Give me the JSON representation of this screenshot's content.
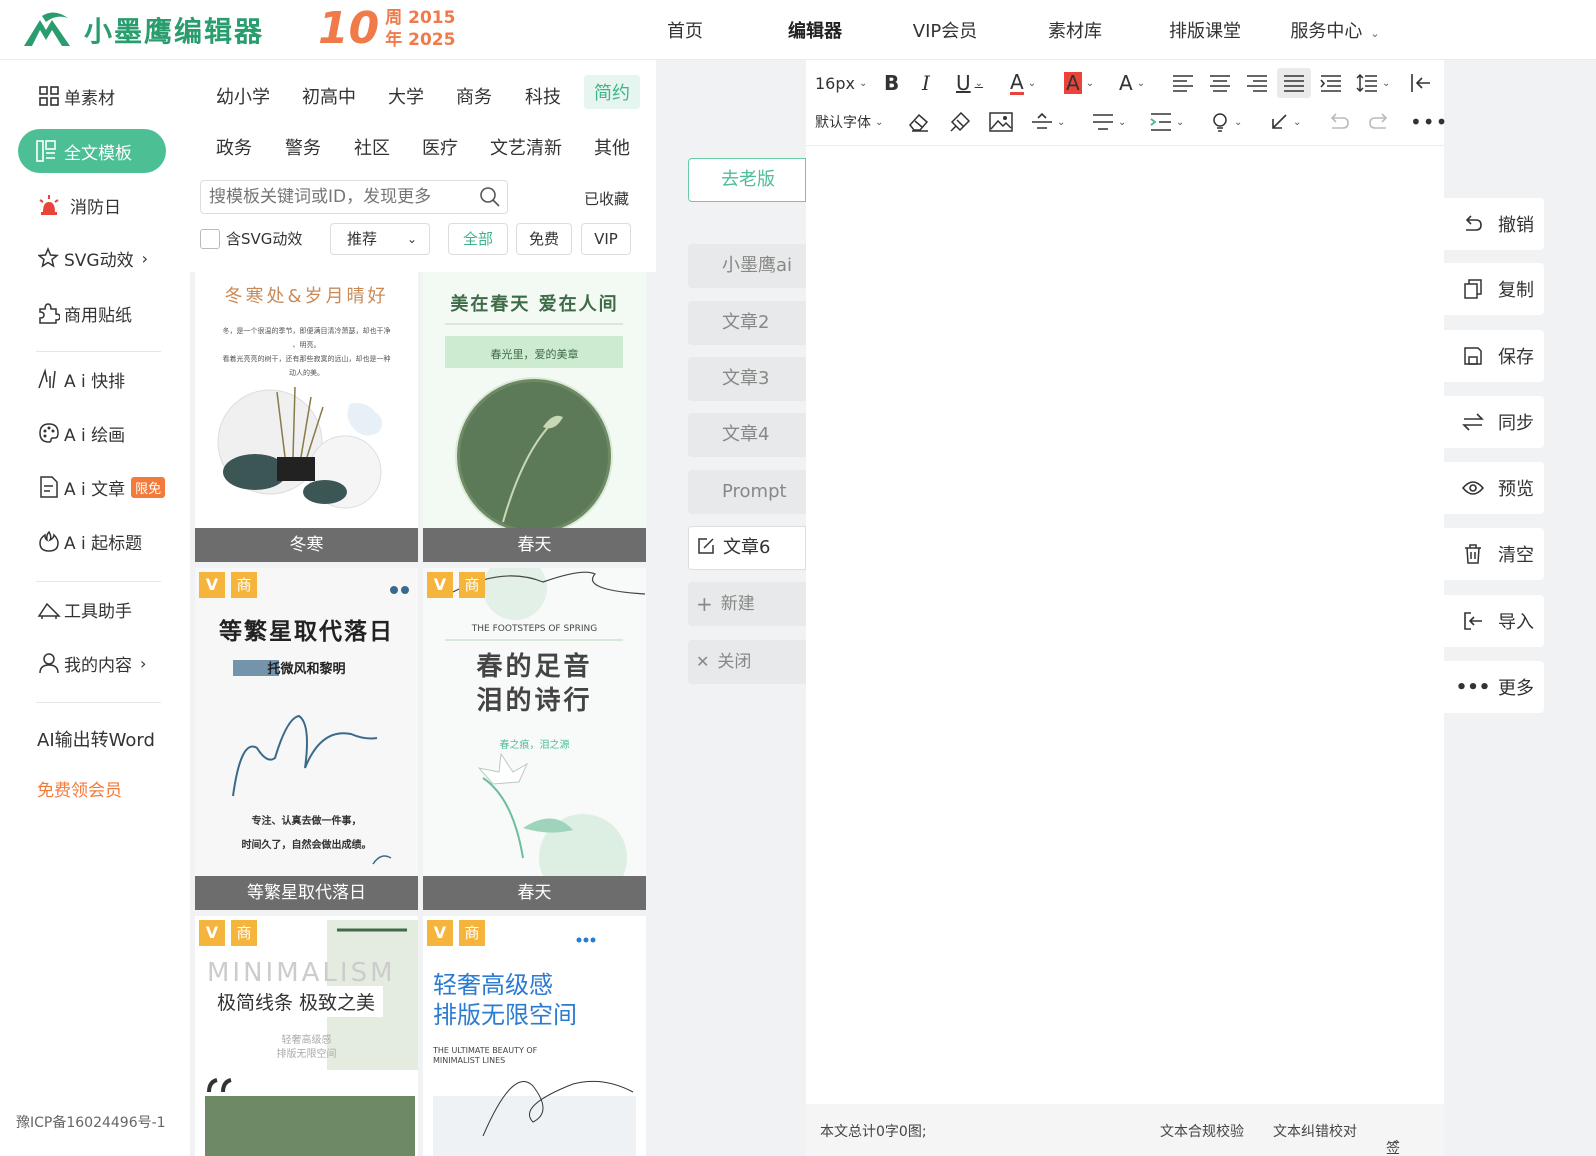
{
  "topbar": {
    "brand": "小墨鹰编辑器",
    "anniversary": {
      "number": "10",
      "line1": "周 2015",
      "line2": "年 2025"
    },
    "nav": [
      {
        "label": "首页",
        "active": false
      },
      {
        "label": "编辑器",
        "active": true
      },
      {
        "label": "VIP会员",
        "active": false
      },
      {
        "label": "素材库",
        "active": false
      },
      {
        "label": "排版课堂",
        "active": false
      },
      {
        "label": "服务中心",
        "active": false
      }
    ]
  },
  "leftnav": {
    "single_material": "单素材",
    "full_template": "全文模板",
    "fire_day": "消防日",
    "svg_effects": "SVG动效",
    "stickers": "商用贴纸",
    "ai_layout": "A i 快排",
    "ai_draw": "A i 绘画",
    "ai_article": "A i 文章",
    "limited_free": "限免",
    "ai_title": "A i 起标题",
    "tools": "工具助手",
    "my_content": "我的内容",
    "ai_word": "AI输出转Word",
    "free_vip": "免费领会员",
    "arrow": "›"
  },
  "icp": "豫ICP备16024496号-1",
  "templates": {
    "categories_row1": [
      "幼小学",
      "初高中",
      "大学",
      "商务",
      "科技",
      "简约"
    ],
    "categories_row2": [
      "政务",
      "警务",
      "社区",
      "医疗",
      "文艺清新",
      "其他"
    ],
    "active_category": "简约",
    "search_placeholder": "搜模板关键词或ID，发现更多",
    "collected": "已收藏",
    "svg_checkbox": "含SVG动效",
    "sort_selected": "推荐",
    "filters": [
      "全部",
      "免费",
      "VIP"
    ],
    "badge_v": "V",
    "badge_s": "商",
    "cards": [
      {
        "label": "冬寒",
        "headline": "冬寒处&岁月晴好",
        "body1": "冬，是一个很温的季节，即便满目清冷萧瑟，却也干净",
        "body2": "、明亮。",
        "body3": "看着光亮亮的树干，还有那些寂寞的远山，却也是一种",
        "body4": "动人的美。"
      },
      {
        "label": "春天",
        "headline": "美在春天 爱在人间",
        "sub": "春光里，爱的美章"
      },
      {
        "label": "等繁星取代落日",
        "headline": "等繁星取代落日",
        "sub": "托微风和黎明",
        "line1": "专注、认真去做一件事，",
        "line2": "时间久了，自然会做出成绩。"
      },
      {
        "label": "春天",
        "eyebrow": "THE FOOTSTEPS OF SPRING",
        "headline1": "春的足音",
        "headline2": "泪的诗行",
        "sub": "春之痕，泪之源"
      },
      {
        "headline_en": "MINIMALISM",
        "headline": "极简线条 极致之美",
        "sub1": "轻奢高级感",
        "sub2": "排版无限空间"
      },
      {
        "headline1": "轻奢高级感",
        "headline2": "排版无限空间",
        "en1": "THE ULTIMATE BEAUTY OF",
        "en2": "MINIMALIST LINES"
      }
    ]
  },
  "middle": {
    "old_version": "去老版",
    "tabs": [
      "小墨鹰ai",
      "文章2",
      "文章3",
      "文章4",
      "Prompt",
      "文章6"
    ],
    "active_tab": "文章6",
    "new": "新建",
    "close": "关闭"
  },
  "editor": {
    "font_size": "16px",
    "font_family": "默认字体",
    "status_count": "本文总计0字0图;",
    "compliance": "文本合规校验",
    "proofread": "文本纠错校对",
    "signature": "签名"
  },
  "right_tools": [
    "撤销",
    "复制",
    "保存",
    "同步",
    "预览",
    "清空",
    "导入",
    "更多"
  ],
  "colors": {
    "brand": "#2a9d6f",
    "accent": "#4cbf95",
    "orange": "#f47a3a",
    "red": "#e8443a"
  }
}
